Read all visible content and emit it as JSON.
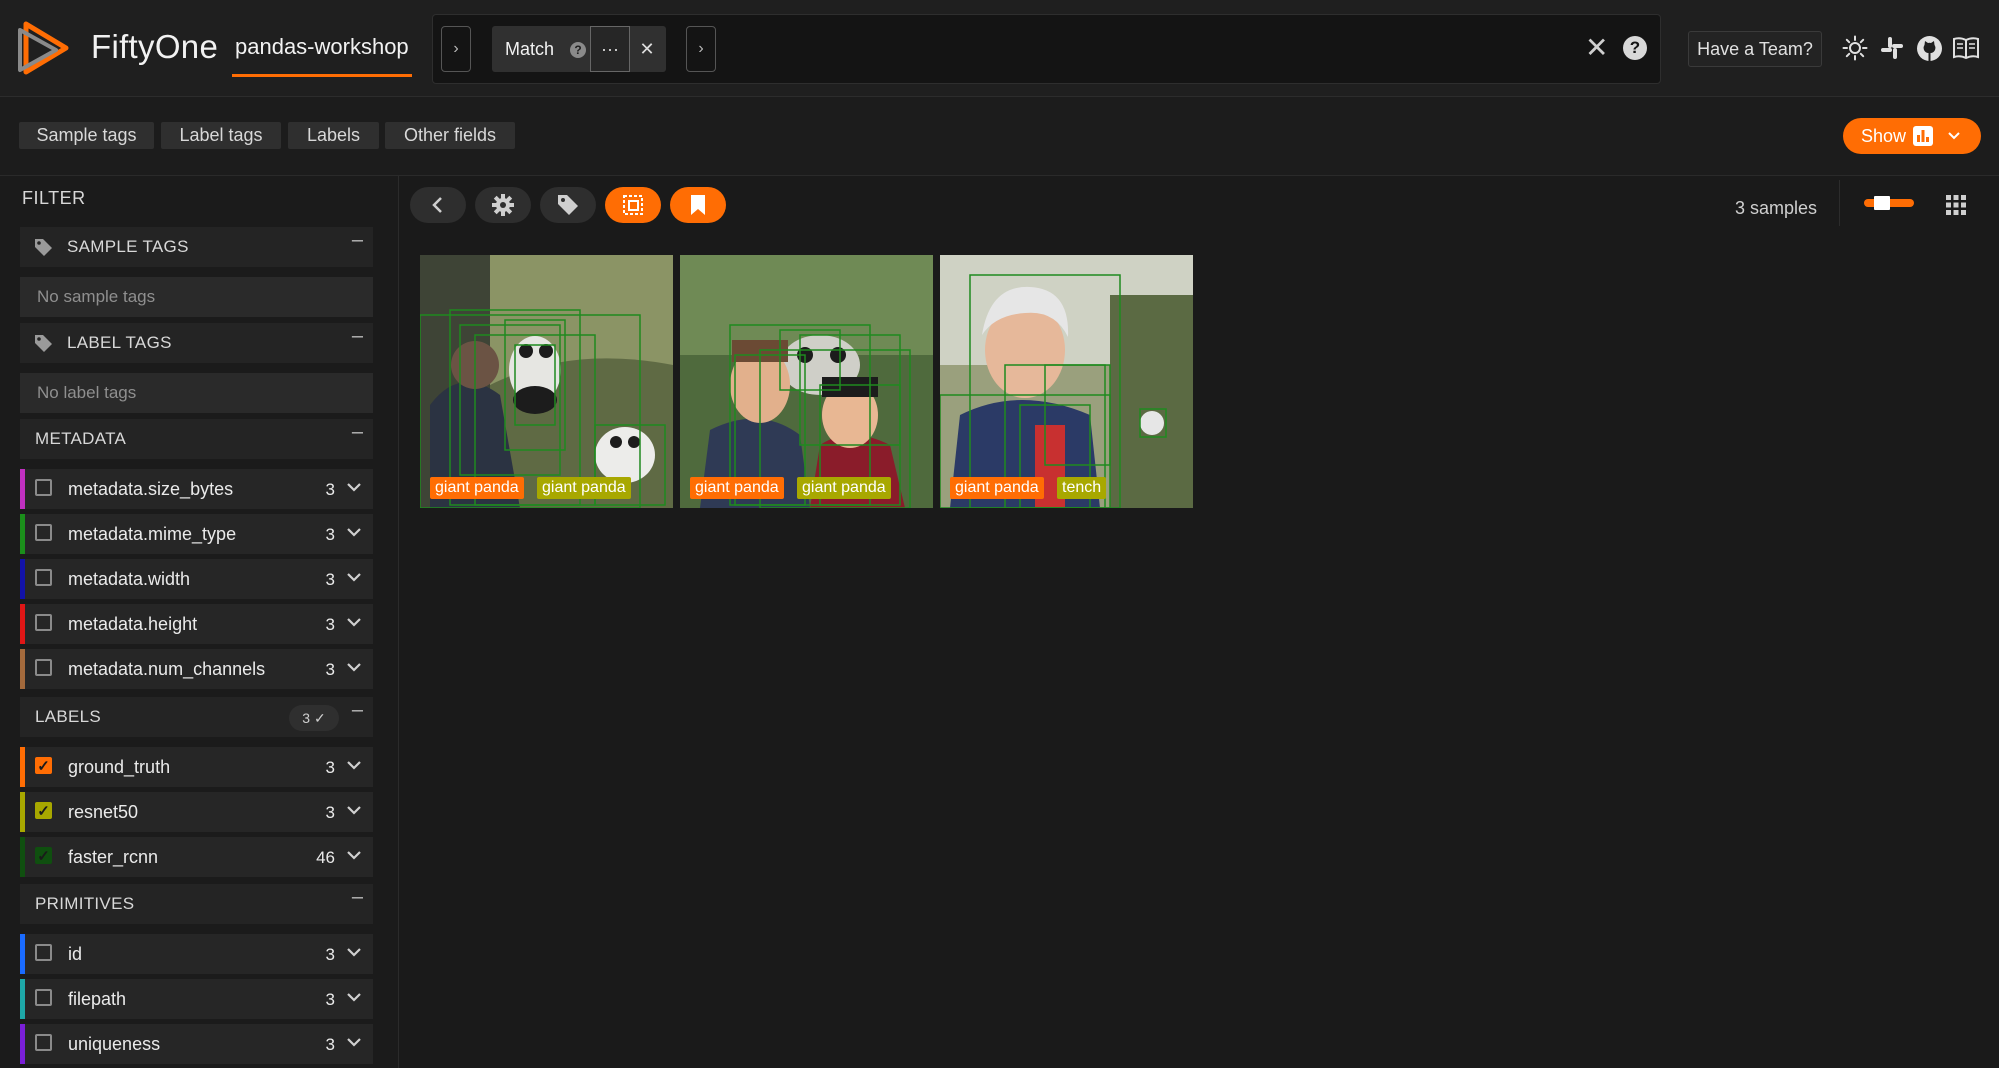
{
  "header": {
    "app_title": "FiftyOne",
    "dataset_name": "pandas-workshop",
    "stage": {
      "label": "Match",
      "help": "?",
      "more": "···",
      "remove": "✕"
    },
    "clear_view": "✕",
    "help": "?",
    "team_button": "Have a Team?",
    "icons": [
      "sun-icon",
      "slack-icon",
      "github-icon",
      "docs-icon"
    ]
  },
  "tabs": [
    {
      "label": "Sample tags"
    },
    {
      "label": "Label tags"
    },
    {
      "label": "Labels"
    },
    {
      "label": "Other fields"
    }
  ],
  "show_button": {
    "label": "Show"
  },
  "sidebar": {
    "filter_label": "FILTER",
    "sample_tags": {
      "title": "SAMPLE TAGS",
      "empty": "No sample tags",
      "minimize": "–"
    },
    "label_tags": {
      "title": "LABEL TAGS",
      "empty": "No label tags",
      "minimize": "–"
    },
    "metadata": {
      "title": "METADATA",
      "minimize": "–",
      "fields": [
        {
          "name": "metadata.size_bytes",
          "count": "3",
          "color": "#c030c0",
          "checked": false
        },
        {
          "name": "metadata.mime_type",
          "count": "3",
          "color": "#1b8f1b",
          "checked": false
        },
        {
          "name": "metadata.width",
          "count": "3",
          "color": "#1212a8",
          "checked": false
        },
        {
          "name": "metadata.height",
          "count": "3",
          "color": "#e01616",
          "checked": false
        },
        {
          "name": "metadata.num_channels",
          "count": "3",
          "color": "#a46a3c",
          "checked": false
        }
      ]
    },
    "labels": {
      "title": "LABELS",
      "badge": "3 ✓",
      "minimize": "–",
      "fields": [
        {
          "name": "ground_truth",
          "count": "3",
          "color": "#ff6d04",
          "checked": true
        },
        {
          "name": "resnet50",
          "count": "3",
          "color": "#a8a800",
          "checked": true
        },
        {
          "name": "faster_rcnn",
          "count": "46",
          "color": "#0f4f0f",
          "checked": true
        }
      ]
    },
    "primitives": {
      "title": "PRIMITIVES",
      "minimize": "–",
      "fields": [
        {
          "name": "id",
          "count": "3",
          "color": "#1a6bff",
          "checked": false
        },
        {
          "name": "filepath",
          "count": "3",
          "color": "#1ea8a8",
          "checked": false
        },
        {
          "name": "uniqueness",
          "count": "3",
          "color": "#7a1fd8",
          "checked": false
        }
      ]
    }
  },
  "main": {
    "samples_count": "3 samples",
    "toolbar_icons": [
      "back-icon",
      "settings-icon",
      "tag-icon",
      "patches-icon",
      "bookmark-icon"
    ],
    "samples": [
      {
        "labels": [
          {
            "text": "giant panda",
            "color": "#ff6d04"
          },
          {
            "text": "giant panda",
            "color": "#a8a800"
          }
        ]
      },
      {
        "labels": [
          {
            "text": "giant panda",
            "color": "#ff6d04"
          },
          {
            "text": "giant panda",
            "color": "#a8a800"
          }
        ]
      },
      {
        "labels": [
          {
            "text": "giant panda",
            "color": "#ff6d04"
          },
          {
            "text": "tench",
            "color": "#a8a800"
          }
        ]
      }
    ]
  },
  "colors": {
    "accent": "#ff6d04",
    "background": "#1a1a1a"
  }
}
